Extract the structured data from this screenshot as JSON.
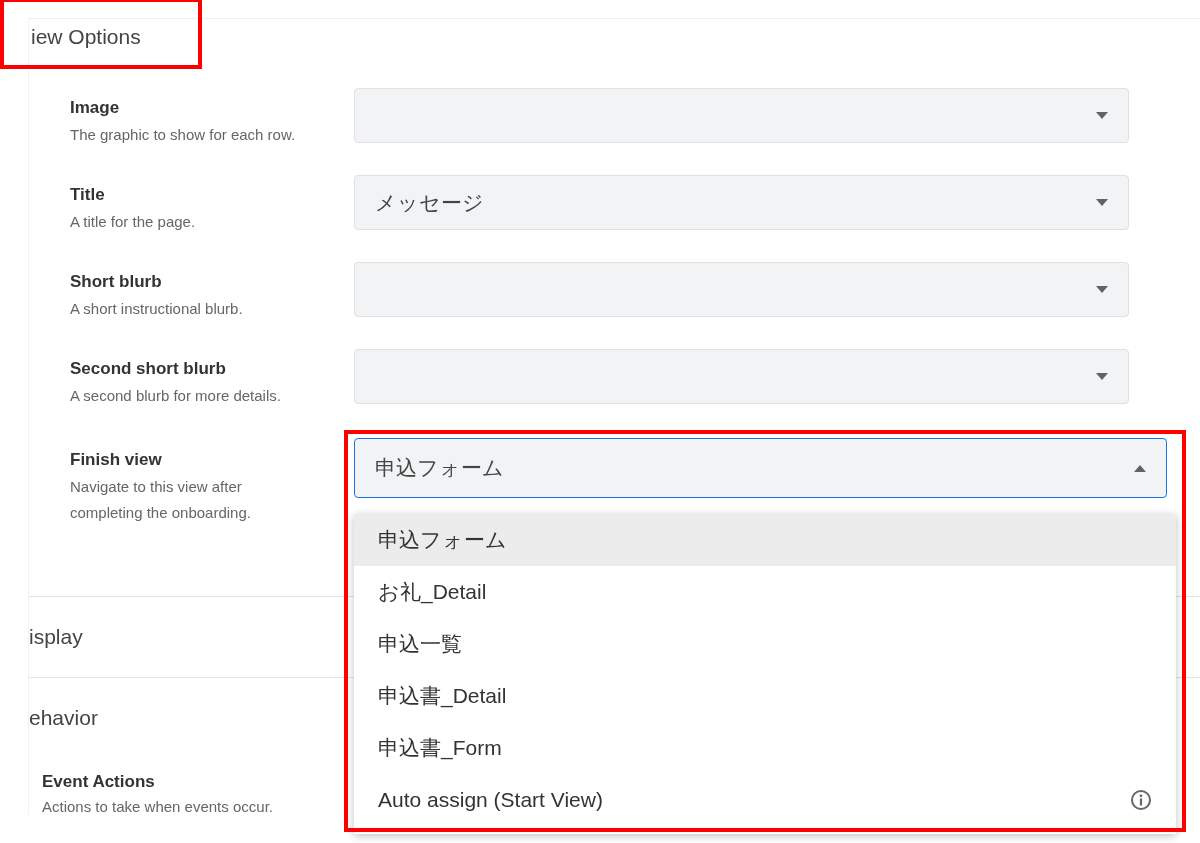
{
  "section": {
    "title": "iew Options",
    "highlighted": true
  },
  "fields": [
    {
      "label": "Image",
      "description": "The graphic to show for each row.",
      "open": false
    },
    {
      "label": "Title",
      "description": "A title for the page.",
      "value": "メッセージ",
      "open": false
    },
    {
      "label": "Short blurb",
      "description": "A short instructional blurb.",
      "open": false
    },
    {
      "label": "Second short blurb",
      "description": "A second blurb for more details.",
      "open": false
    },
    {
      "label": "Finish view",
      "description": "Navigate to this view after completing the onboarding.",
      "value": "申込フォーム",
      "open": true,
      "highlighted": true,
      "options": [
        {
          "label": "申込フォーム",
          "selected": true,
          "kind": "plain"
        },
        {
          "label": "お礼_Detail",
          "selected": false,
          "kind": "plain"
        },
        {
          "label": "申込一覧",
          "selected": false,
          "kind": "plain"
        },
        {
          "label": "申込書_Detail",
          "selected": false,
          "kind": "plain"
        },
        {
          "label": "申込書_Form",
          "selected": false,
          "kind": "plain"
        },
        {
          "label": "Auto assign (Start View)",
          "selected": false,
          "kind": "info"
        }
      ]
    }
  ],
  "collapsed_sections": [
    {
      "title": "isplay"
    },
    {
      "title": "ehavior"
    }
  ],
  "behavior_fields": [
    {
      "label": "Event Actions",
      "description": "Actions to take when events occur."
    }
  ]
}
